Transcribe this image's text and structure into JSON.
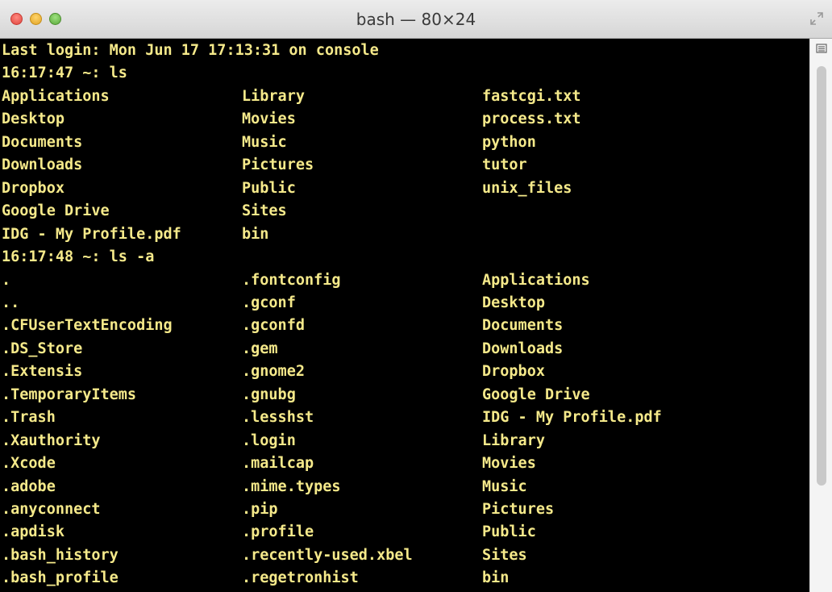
{
  "window": {
    "title": "bash — 80×24"
  },
  "terminal": {
    "lines": [
      {
        "cols": [
          "Last login: Mon Jun 17 17:13:31 on console",
          "",
          ""
        ]
      },
      {
        "cols": [
          "16:17:47 ~: ls",
          "",
          ""
        ]
      },
      {
        "cols": [
          "Applications",
          "Library",
          "fastcgi.txt"
        ]
      },
      {
        "cols": [
          "Desktop",
          "Movies",
          "process.txt"
        ]
      },
      {
        "cols": [
          "Documents",
          "Music",
          "python"
        ]
      },
      {
        "cols": [
          "Downloads",
          "Pictures",
          "tutor"
        ]
      },
      {
        "cols": [
          "Dropbox",
          "Public",
          "unix_files"
        ]
      },
      {
        "cols": [
          "Google Drive",
          "Sites",
          ""
        ]
      },
      {
        "cols": [
          "IDG - My Profile.pdf",
          "bin",
          ""
        ]
      },
      {
        "cols": [
          "16:17:48 ~: ls -a",
          "",
          ""
        ]
      },
      {
        "cols": [
          ".",
          ".fontconfig",
          "Applications"
        ]
      },
      {
        "cols": [
          "..",
          ".gconf",
          "Desktop"
        ]
      },
      {
        "cols": [
          ".CFUserTextEncoding",
          ".gconfd",
          "Documents"
        ]
      },
      {
        "cols": [
          ".DS_Store",
          ".gem",
          "Downloads"
        ]
      },
      {
        "cols": [
          ".Extensis",
          ".gnome2",
          "Dropbox"
        ]
      },
      {
        "cols": [
          ".TemporaryItems",
          ".gnubg",
          "Google Drive"
        ]
      },
      {
        "cols": [
          ".Trash",
          ".lesshst",
          "IDG - My Profile.pdf"
        ]
      },
      {
        "cols": [
          ".Xauthority",
          ".login",
          "Library"
        ]
      },
      {
        "cols": [
          ".Xcode",
          ".mailcap",
          "Movies"
        ]
      },
      {
        "cols": [
          ".adobe",
          ".mime.types",
          "Music"
        ]
      },
      {
        "cols": [
          ".anyconnect",
          ".pip",
          "Pictures"
        ]
      },
      {
        "cols": [
          ".apdisk",
          ".profile",
          "Public"
        ]
      },
      {
        "cols": [
          ".bash_history",
          ".recently-used.xbel",
          "Sites"
        ]
      },
      {
        "cols": [
          ".bash_profile",
          ".regetronhist",
          "bin"
        ]
      }
    ]
  },
  "colors": {
    "terminal_background": "#000000",
    "terminal_text": "#f5e98a"
  },
  "icons": {
    "close": "close-icon",
    "minimize": "minimize-icon",
    "zoom": "zoom-icon",
    "fullscreen": "fullscreen-arrows-icon",
    "scroll_menu": "hamburger-icon"
  }
}
